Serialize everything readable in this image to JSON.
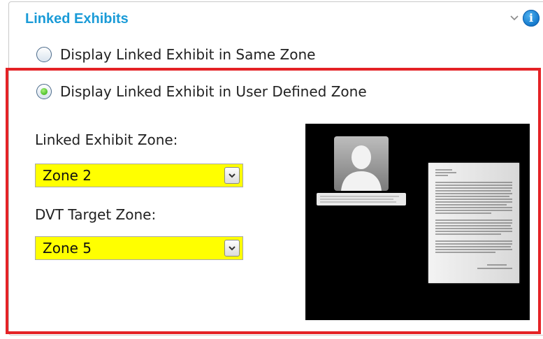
{
  "panel": {
    "title": "Linked Exhibits",
    "icons": {
      "collapse": "chevron-down-icon",
      "info": "info-icon"
    },
    "info_glyph": "i"
  },
  "radio_options": [
    {
      "label": "Display Linked Exhibit in Same Zone",
      "checked": false
    },
    {
      "label": "Display Linked Exhibit in User Defined Zone",
      "checked": true
    }
  ],
  "fields": {
    "linked_exhibit_zone": {
      "label": "Linked Exhibit Zone:",
      "value": "Zone 2"
    },
    "dvt_target_zone": {
      "label": "DVT Target Zone:",
      "value": "Zone 5"
    }
  },
  "colors": {
    "title": "#1a9bd7",
    "highlight_border": "#e42226",
    "select_background": "#ffff00",
    "preview_background": "#000000"
  }
}
